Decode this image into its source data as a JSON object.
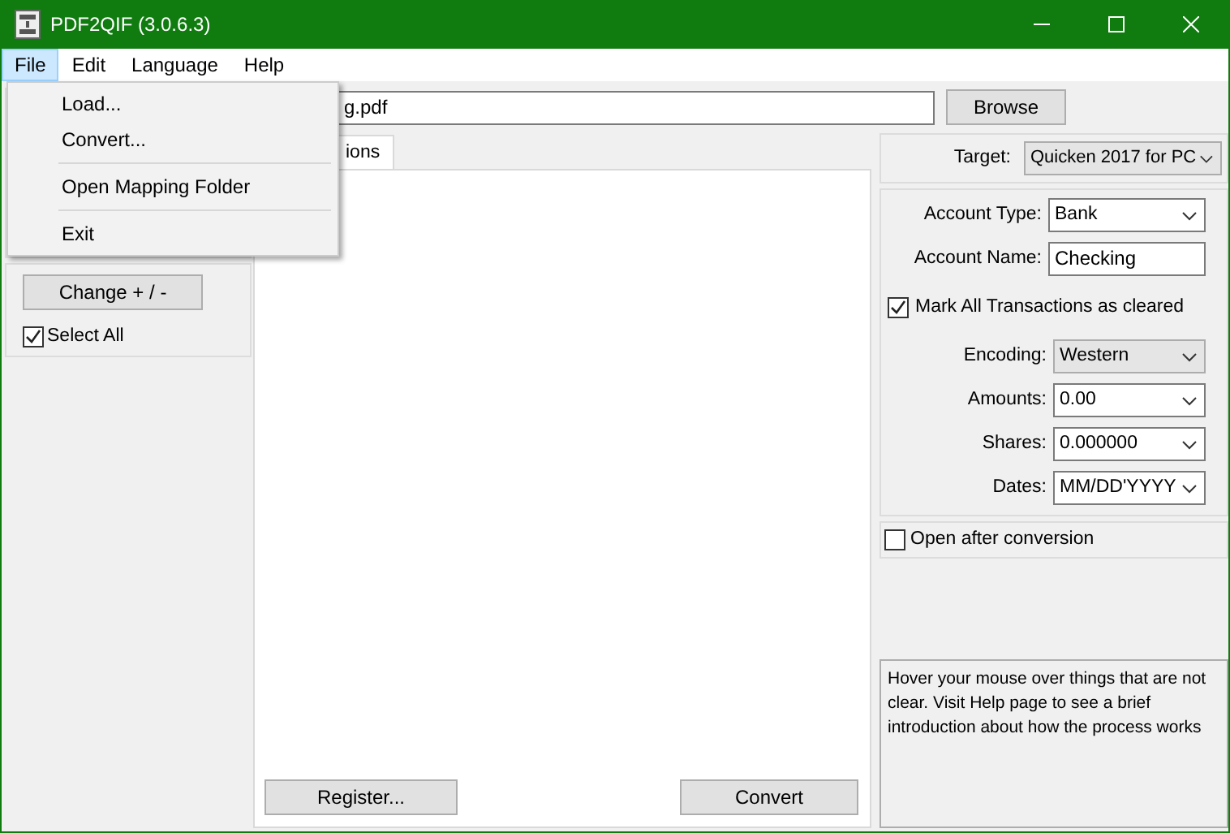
{
  "window": {
    "title": "PDF2QIF (3.0.6.3)"
  },
  "menu_bar": [
    {
      "label": "File",
      "selected": true
    },
    {
      "label": "Edit",
      "selected": false
    },
    {
      "label": "Language",
      "selected": false
    },
    {
      "label": "Help",
      "selected": false
    }
  ],
  "open_menu": [
    {
      "kind": "item",
      "label": "Load..."
    },
    {
      "kind": "item",
      "label": "Convert..."
    },
    {
      "kind": "separator"
    },
    {
      "kind": "item",
      "label": "Open Mapping Folder"
    },
    {
      "kind": "separator"
    },
    {
      "kind": "item",
      "label": "Exit"
    }
  ],
  "file_field": {
    "value": "g.pdf"
  },
  "browse_button": "Browse",
  "tab": {
    "label": "ions",
    "selected": true
  },
  "left_panel": {
    "change_button": "Change + / -",
    "select_all": {
      "label": "Select All",
      "checked": true
    }
  },
  "target": {
    "label": "Target:",
    "value": "Quicken 2017 for PC"
  },
  "settings": [
    {
      "kind": "select",
      "label": "Account Type:",
      "value": "Bank"
    },
    {
      "kind": "input",
      "label": "Account Name:",
      "value": "Checking"
    },
    {
      "kind": "checkbox",
      "label": "Mark All Transactions as cleared",
      "checked": true
    },
    {
      "kind": "combo",
      "label": "Encoding:",
      "value": "Western"
    },
    {
      "kind": "select",
      "label": "Amounts:",
      "value": "0.00"
    },
    {
      "kind": "select",
      "label": "Shares:",
      "value": "0.000000"
    },
    {
      "kind": "select",
      "label": "Dates:",
      "value": "MM/DD'YYYY"
    }
  ],
  "open_after": {
    "label": "Open after conversion",
    "checked": false
  },
  "help_text": "Hover your mouse over things that are not clear. Visit Help page to see a brief introduction about how the process works",
  "buttons": [
    "Register...",
    "Convert"
  ]
}
